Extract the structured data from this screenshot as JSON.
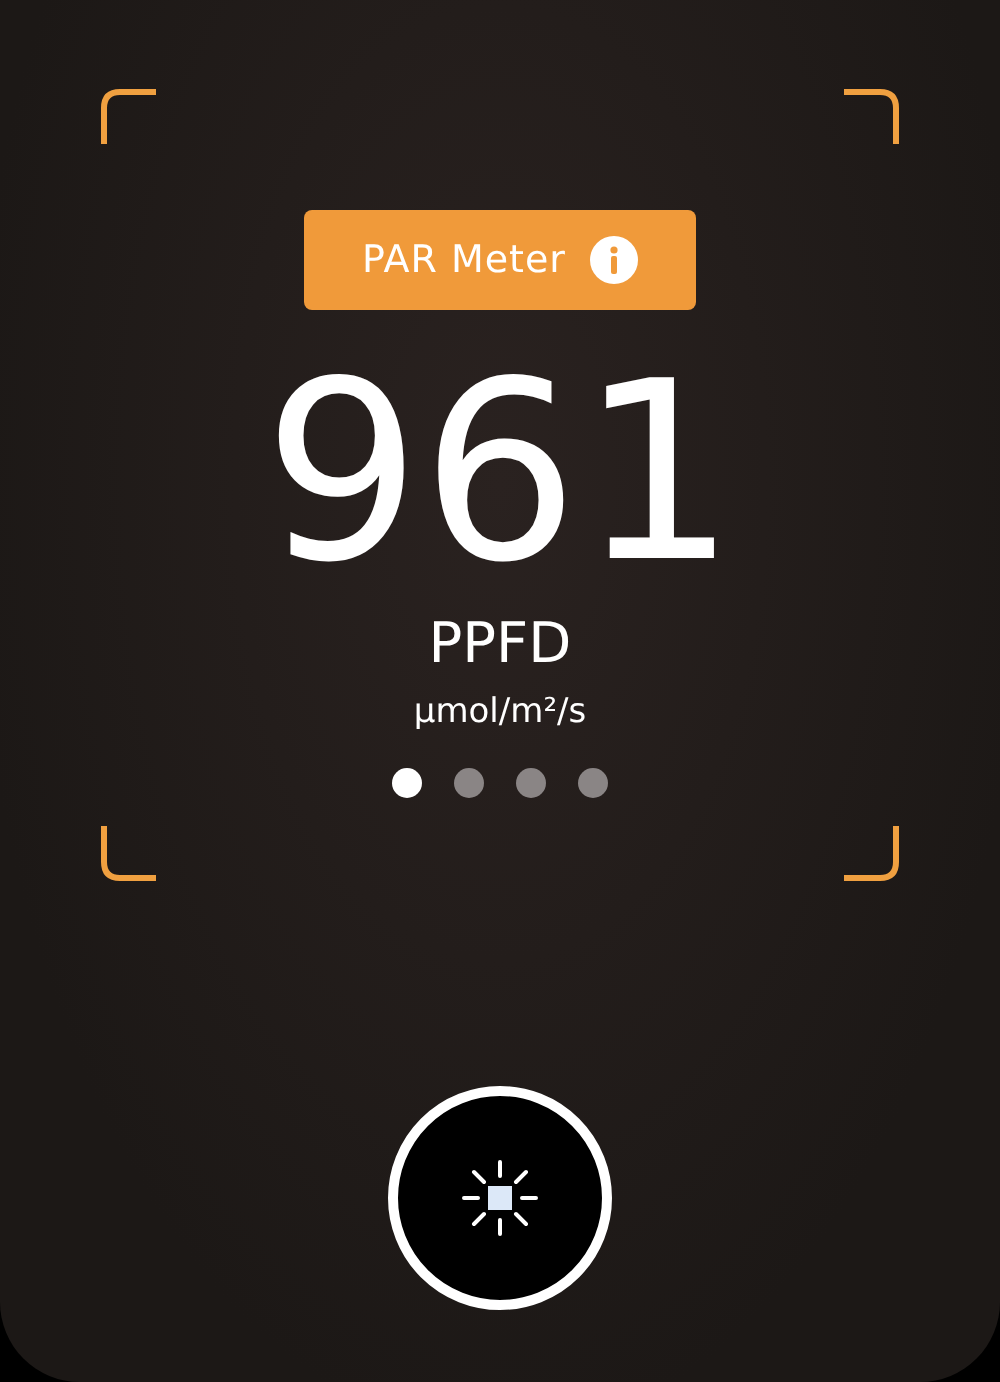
{
  "badge": {
    "label": "PAR Meter"
  },
  "reading": {
    "value": "961",
    "quantity": "PPFD",
    "unit": "µmol/m²/s"
  },
  "pages": [
    {
      "selected": true
    },
    {
      "selected": false
    },
    {
      "selected": false
    },
    {
      "selected": false
    }
  ]
}
